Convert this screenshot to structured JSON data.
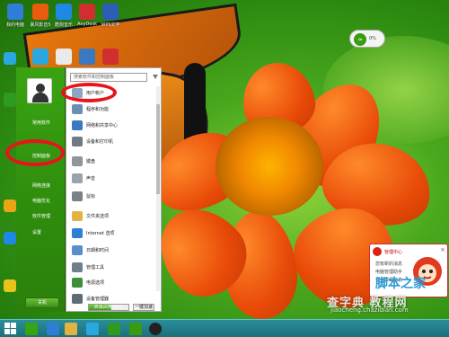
{
  "desktop": {
    "top_icons": [
      {
        "label": "我的电脑",
        "color": "#2e7dd7"
      },
      {
        "label": "暴风影音5",
        "color": "#e95b0f"
      },
      {
        "label": "酷狗音乐",
        "color": "#1e88e5"
      },
      {
        "label": "AnyDesk",
        "color": "#d12f2f"
      },
      {
        "label": "WPS文字",
        "color": "#2d5eb5"
      }
    ],
    "side_icons": [
      {
        "color": "#2aa7e0"
      },
      {
        "color": "#2e9a22"
      },
      {
        "color": "#e8a515"
      },
      {
        "color": "#c22c2c"
      },
      {
        "color": "#3a9a10"
      },
      {
        "color": "#1e88e5"
      }
    ]
  },
  "start_menu": {
    "left_items": [
      {
        "label": "常用软件"
      },
      {
        "label": "控制面板"
      },
      {
        "label": "网络连接"
      },
      {
        "label": "电脑优化"
      },
      {
        "label": "软件管理"
      },
      {
        "label": "设置"
      }
    ],
    "shutdown_label": "关机",
    "search_placeholder": "搜索软件和控制面板",
    "items": [
      {
        "label": "用户帐户",
        "color": "#8aa6c4"
      },
      {
        "label": "程序和功能",
        "color": "#6b8fb3"
      },
      {
        "label": "网络和共享中心",
        "color": "#3a78c0"
      },
      {
        "label": "设备和打印机",
        "color": "#707a85"
      },
      {
        "label": "键盘",
        "color": "#8f959b"
      },
      {
        "label": "声音",
        "color": "#9aa3ad"
      },
      {
        "label": "鼠标",
        "color": "#7a8088"
      },
      {
        "label": "文件夹选项",
        "color": "#e3b341"
      },
      {
        "label": "Internet 选项",
        "color": "#2e7dd7"
      },
      {
        "label": "日期和时间",
        "color": "#5d8ccc"
      },
      {
        "label": "管理工具",
        "color": "#6e7f8e"
      },
      {
        "label": "电源选项",
        "color": "#3f8f3a"
      },
      {
        "label": "设备管理器",
        "color": "#5f6c78"
      }
    ],
    "progress_label": "资源占用 56%",
    "progress_value": 0.56,
    "onekey_label": "一键加速"
  },
  "network_widget": {
    "percent": "0%"
  },
  "popup": {
    "title": "管理中心",
    "lines": [
      "您有新的消息",
      "电脑管理助手",
      "查看详细信息"
    ]
  },
  "watermark": {
    "line1": "查字典 教程网",
    "line2": "jiaocheng.chazidian.com",
    "brand": "脚本之家"
  }
}
